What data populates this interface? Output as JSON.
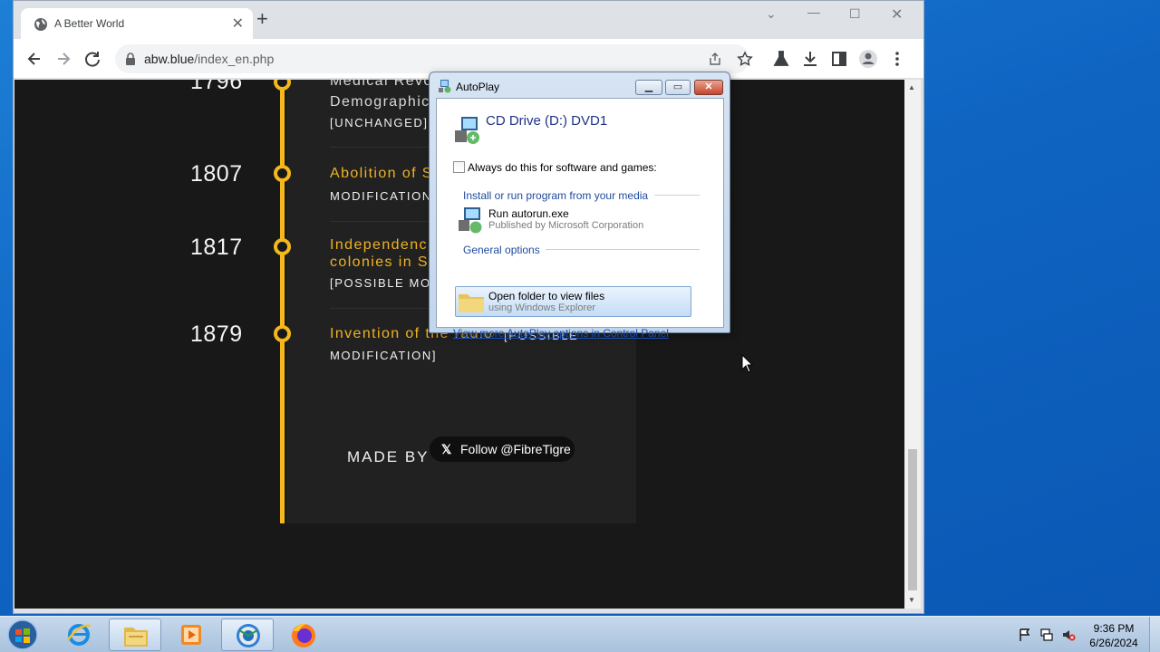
{
  "browser": {
    "tab_title": "A Better World",
    "url_host": "abw.blue",
    "url_path": "/index_en.php"
  },
  "page": {
    "timeline": [
      {
        "year": "1796",
        "event_line1": "Medical Revo",
        "event_line2": "Demographic",
        "tag": "[UNCHANGED]"
      },
      {
        "year": "1807",
        "event_line1": "Abolition of S",
        "tag": "MODIFICATION"
      },
      {
        "year": "1817",
        "event_line1": "Independenc",
        "event_line2": "colonies in S",
        "tag": "[POSSIBLE MO"
      },
      {
        "year": "1879",
        "event_line1": "Invention of the radio",
        "event_tail": "[POSSIBLE",
        "tag": "MODIFICATION]"
      }
    ],
    "made_by": "MADE BY",
    "follow_button": "Follow @FibreTigre"
  },
  "autoplay": {
    "window_title": "AutoPlay",
    "drive_title": "CD Drive (D:) DVD1",
    "always_do_label": "Always do this for software and games:",
    "section_install": "Install or run program from your media",
    "run_title": "Run autorun.exe",
    "run_sub": "Published by Microsoft Corporation",
    "section_general": "General options",
    "open_folder_title": "Open folder to view files",
    "open_folder_sub": "using Windows Explorer",
    "control_panel_link": "View more AutoPlay options in Control Panel"
  },
  "taskbar": {
    "time": "9:36 PM",
    "date": "6/26/2024",
    "items": [
      "internet-explorer",
      "file-explorer",
      "media-player",
      "chrome",
      "firefox"
    ]
  },
  "colors": {
    "timeline_gold": "#f5b81c",
    "page_bg": "#181818",
    "link_blue": "#1a4fb0"
  }
}
